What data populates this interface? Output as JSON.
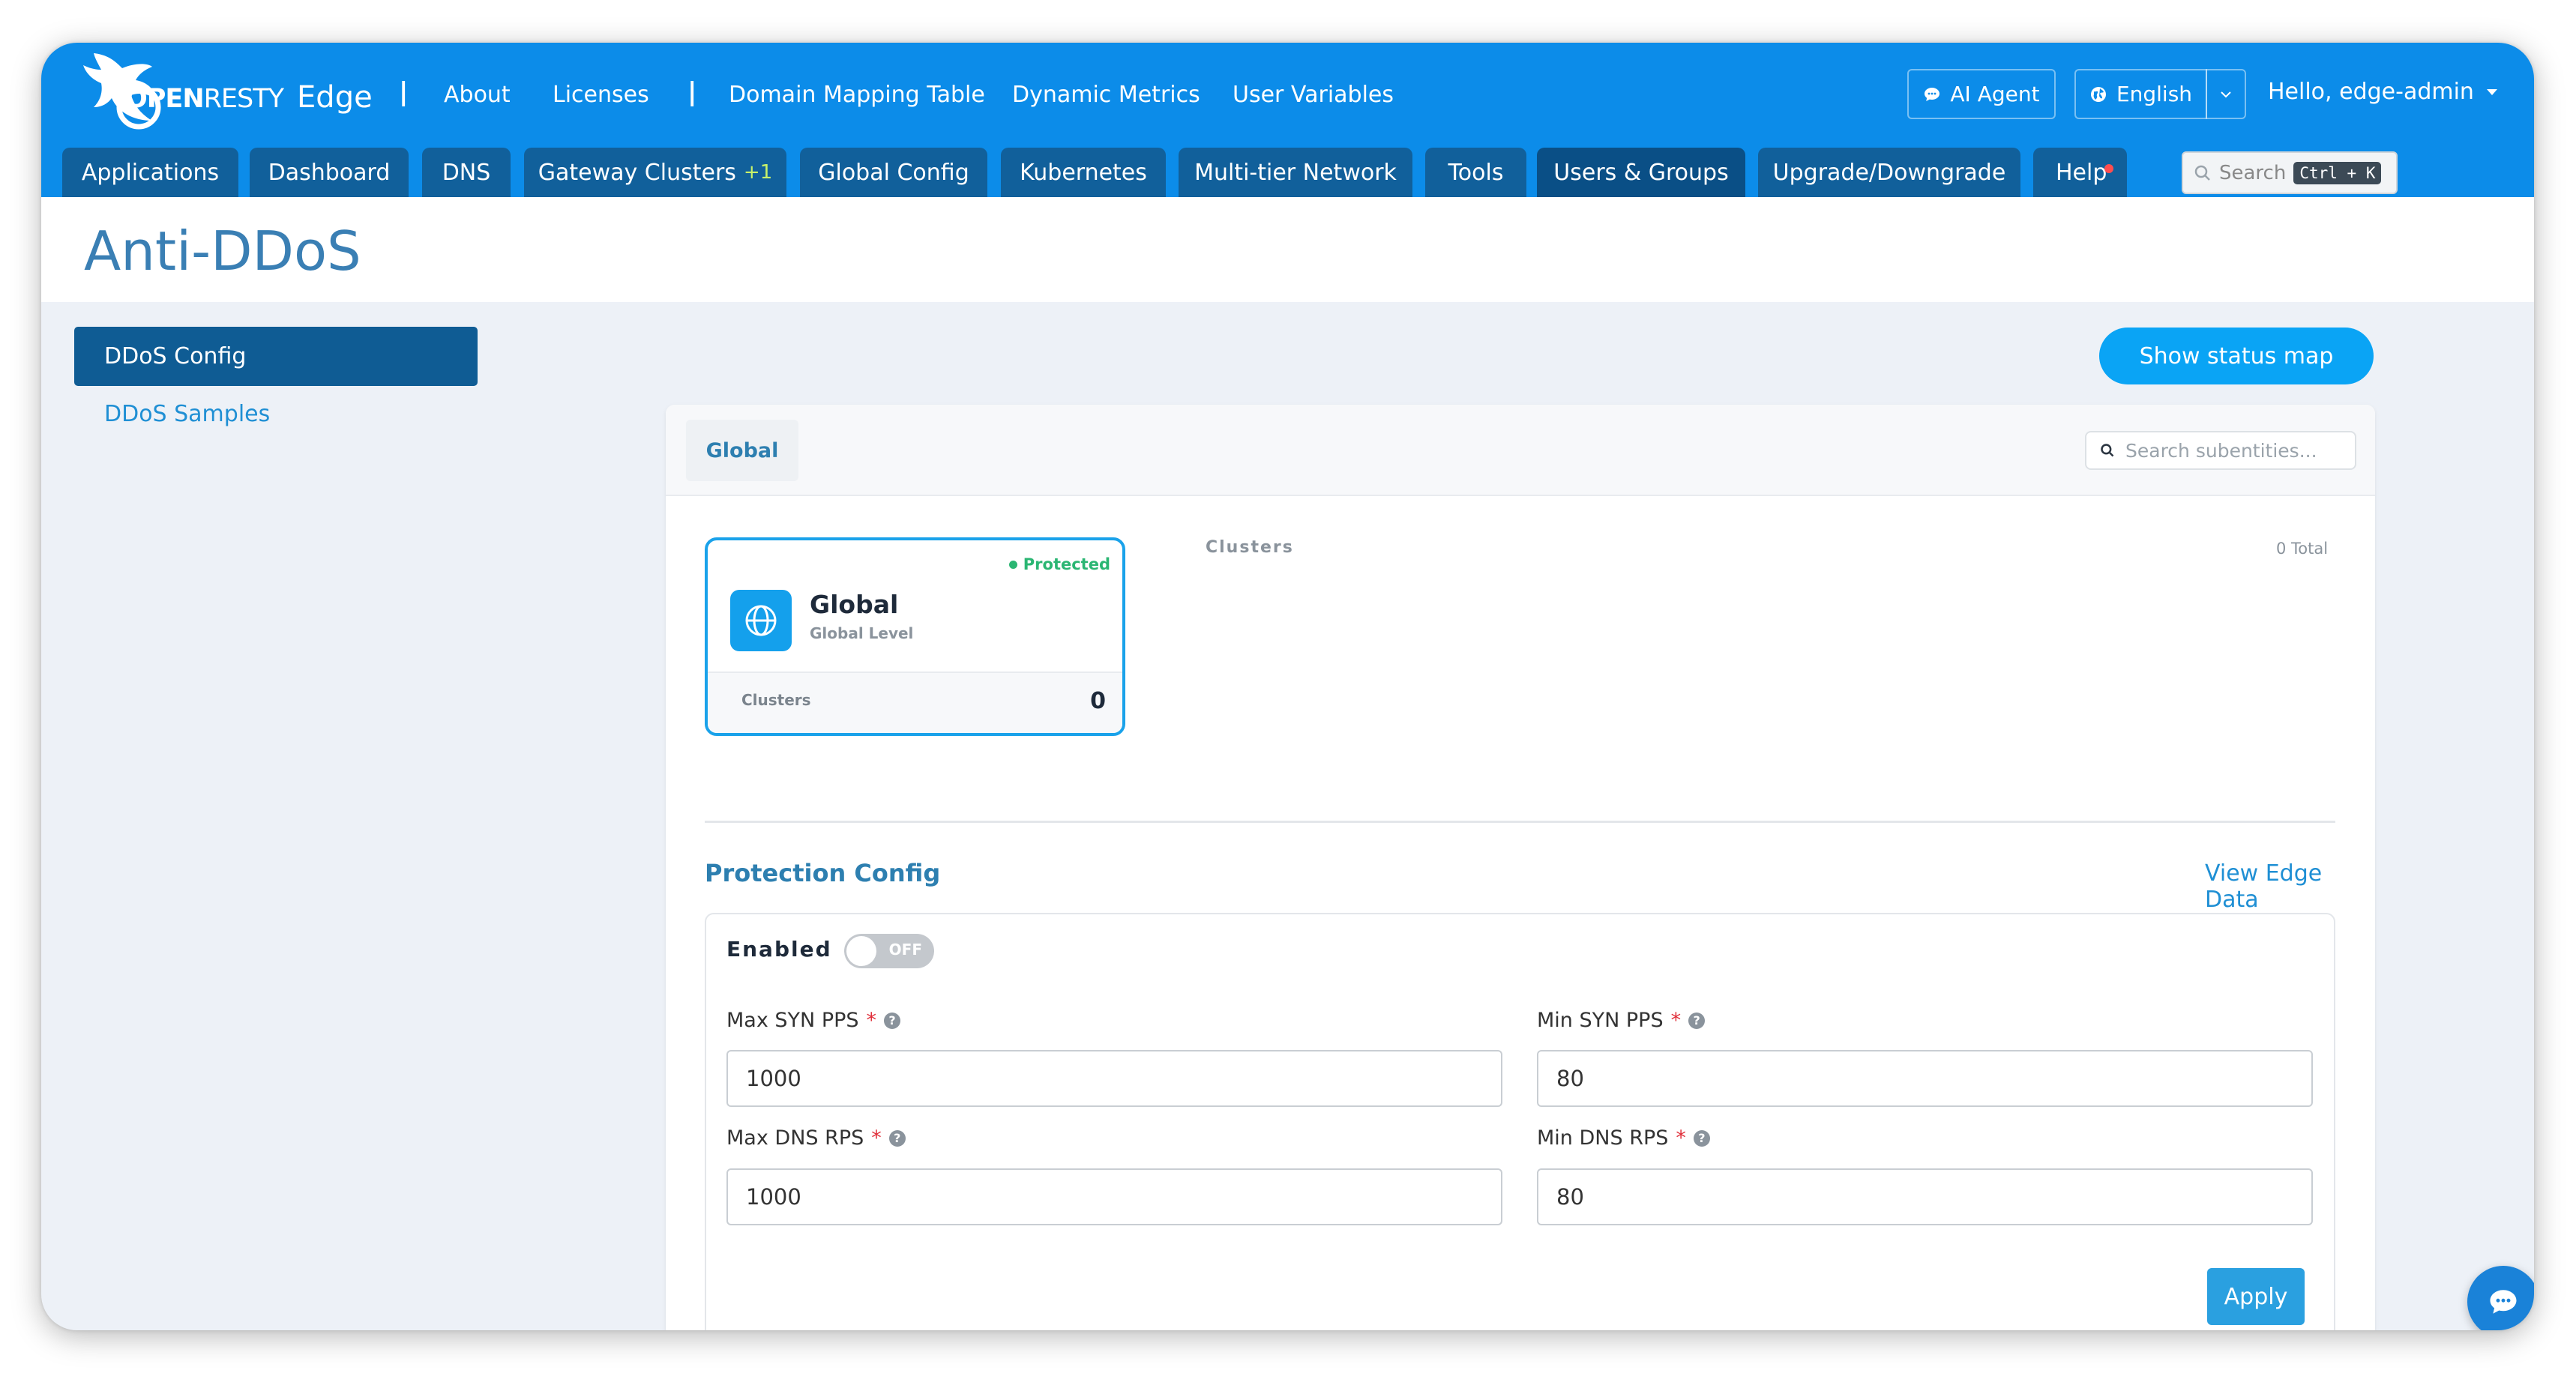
{
  "header": {
    "logo_open": "OPEN",
    "logo_resty": "RESTY",
    "logo_product": "Edge",
    "top_links": [
      "About",
      "Licenses",
      "Domain Mapping Table",
      "Dynamic Metrics",
      "User Variables"
    ],
    "separator": "|",
    "ai_agent_label": "AI Agent",
    "language_label": "English",
    "user_greeting": "Hello, edge-admin",
    "search_placeholder": "Search",
    "search_shortcut": "Ctrl + K"
  },
  "tabs": [
    {
      "label": "Applications"
    },
    {
      "label": "Dashboard"
    },
    {
      "label": "DNS"
    },
    {
      "label": "Gateway Clusters",
      "badge": "+1"
    },
    {
      "label": "Global Config"
    },
    {
      "label": "Kubernetes"
    },
    {
      "label": "Multi-tier Network"
    },
    {
      "label": "Tools"
    },
    {
      "label": "Users & Groups",
      "active": true
    },
    {
      "label": "Upgrade/Downgrade"
    },
    {
      "label": "Help",
      "notification": true
    }
  ],
  "page": {
    "title": "Anti-DDoS"
  },
  "sidebar": {
    "items": [
      {
        "label": "DDoS Config",
        "active": true
      },
      {
        "label": "DDoS Samples"
      }
    ]
  },
  "main": {
    "status_map_button": "Show status map",
    "scope_tab": "Global",
    "search_placeholder": "Search subentities...",
    "entity": {
      "status": "Protected",
      "name": "Global",
      "level": "Global Level",
      "footer_label": "Clusters",
      "footer_value": "0"
    },
    "clusters_label": "Clusters",
    "clusters_total": "0 Total",
    "protection": {
      "title": "Protection Config",
      "link": "View Edge Data",
      "enabled_label": "Enabled",
      "toggle_state": "OFF",
      "fields": {
        "max_syn_pps": {
          "label": "Max SYN PPS",
          "value": "1000"
        },
        "min_syn_pps": {
          "label": "Min SYN PPS",
          "value": "80"
        },
        "max_dns_rps": {
          "label": "Max DNS RPS",
          "value": "1000"
        },
        "min_dns_rps": {
          "label": "Min DNS RPS",
          "value": "80"
        }
      },
      "required_mark": "*",
      "help_mark": "?",
      "apply_label": "Apply"
    }
  },
  "colors": {
    "header_bg": "#0c8ce9",
    "tab_bg": "#11609b",
    "active_tab_bg": "#0a4f86",
    "accent": "#0aa4f5",
    "protected": "#2bb673"
  }
}
